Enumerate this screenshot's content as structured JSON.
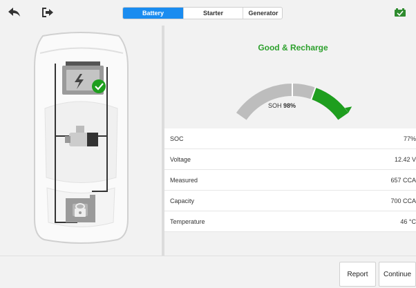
{
  "toolbar": {
    "back_icon": "back-arrow-icon",
    "exit_icon": "exit-icon",
    "battery_status_icon": "battery-check-icon"
  },
  "tabs": [
    {
      "label": "Battery",
      "active": true
    },
    {
      "label": "Starter",
      "active": false
    },
    {
      "label": "Generator",
      "active": false
    }
  ],
  "result": {
    "status": "Good & Recharge",
    "status_color": "#2ca02c",
    "soh_label": "SOH",
    "soh_value": "98%",
    "soh_fraction": 0.98
  },
  "rows": [
    {
      "label": "SOC",
      "value": "77%"
    },
    {
      "label": "Voltage",
      "value": "12.42 V"
    },
    {
      "label": "Measured",
      "value": "657 CCA"
    },
    {
      "label": "Capacity",
      "value": "700 CCA"
    },
    {
      "label": "Temperature",
      "value": "46 °C"
    }
  ],
  "buttons": {
    "report": "Report",
    "continue": "Continue"
  },
  "colors": {
    "accent": "#1a8cf0",
    "good": "#1e9e1e",
    "gauge_grey": "#bdbdbd"
  }
}
